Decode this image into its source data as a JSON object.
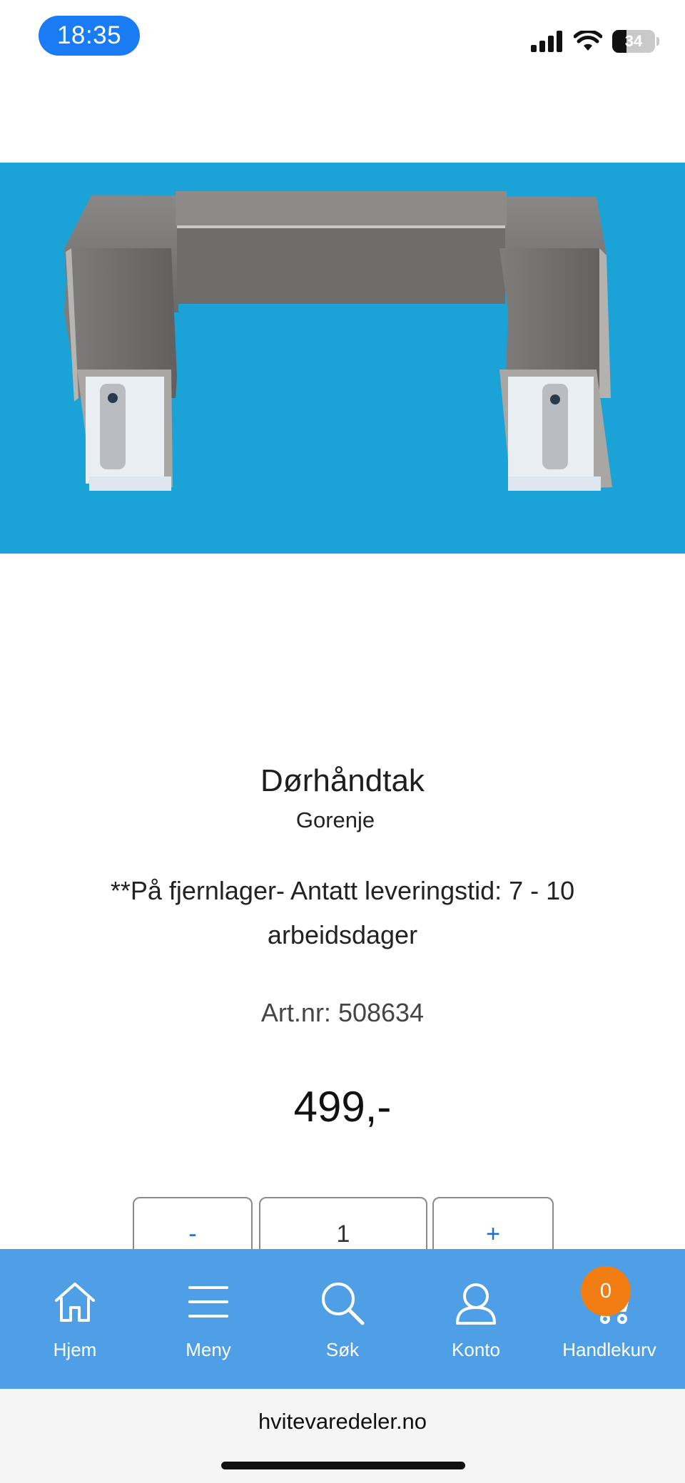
{
  "status_bar": {
    "time": "18:35",
    "battery": "34",
    "battery_level": 0.34,
    "icons": [
      "cellular-signal-icon",
      "wifi-icon",
      "battery-icon"
    ]
  },
  "product": {
    "image_alt": "door-handle-product-photo",
    "title": "Dørhåndtak",
    "brand": "Gorenje",
    "stock_note": "**På fjernlager- Antatt leveringstid: 7 - 10 arbeidsdager",
    "art_nr": "Art.nr: 508634",
    "price": "499,-"
  },
  "quantity": {
    "minus_label": "-",
    "value": "1",
    "plus_label": "+"
  },
  "bottom_nav": {
    "items": [
      {
        "label": "Hjem",
        "icon": "home-icon"
      },
      {
        "label": "Meny",
        "icon": "menu-icon"
      },
      {
        "label": "Søk",
        "icon": "search-icon"
      },
      {
        "label": "Konto",
        "icon": "user-icon"
      },
      {
        "label": "Handlekurv",
        "icon": "cart-icon"
      }
    ],
    "cart_count": "0"
  },
  "browser": {
    "url": "hvitevaredeler.no"
  },
  "colors": {
    "accent": "#4e9fe6",
    "badge": "#f27d12",
    "time_pill": "#1a7cf5",
    "image_bg": "#1ba3d8"
  }
}
